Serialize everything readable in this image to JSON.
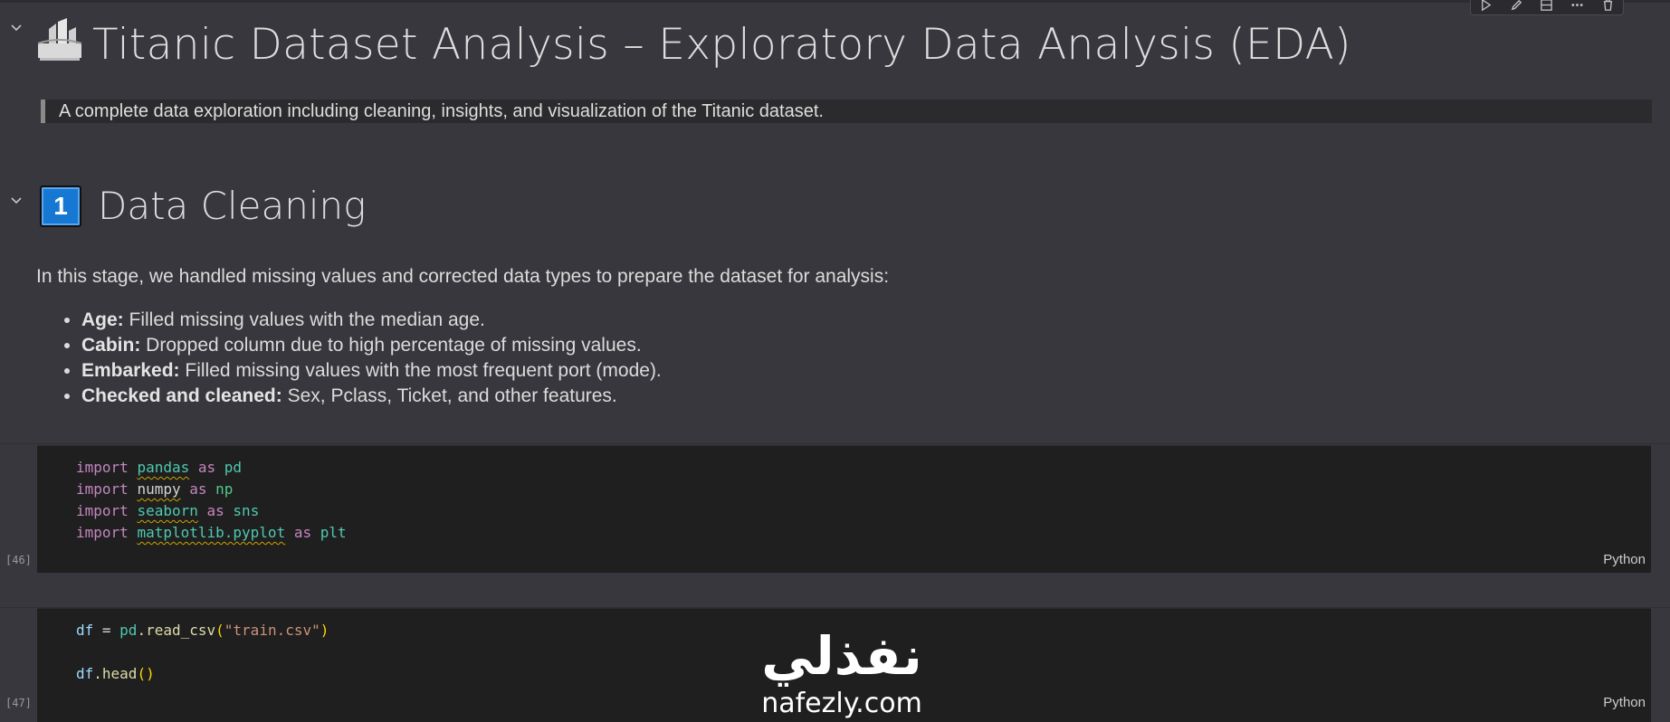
{
  "toolbar": {
    "icons": [
      "run-cell-icon",
      "edit-icon",
      "split-cell-icon",
      "more-icon",
      "delete-icon"
    ]
  },
  "heading": {
    "icon": "ship-icon",
    "title": "Titanic Dataset Analysis – Exploratory Data Analysis (EDA)"
  },
  "quote": "A complete data exploration including cleaning, insights, and visualization of the Titanic dataset.",
  "section": {
    "number": "1",
    "title": "Data Cleaning",
    "intro": "In this stage, we handled missing values and corrected data types to prepare the dataset for analysis:",
    "items": [
      {
        "label": "Age:",
        "text": " Filled missing values with the median age."
      },
      {
        "label": "Cabin:",
        "text": " Dropped column due to high percentage of missing values."
      },
      {
        "label": "Embarked:",
        "text": " Filled missing values with the most frequent port (mode)."
      },
      {
        "label": "Checked and cleaned:",
        "text": " Sex, Pclass, Ticket, and other features."
      }
    ]
  },
  "cells": [
    {
      "exec": "[46]",
      "language": "Python",
      "lines": [
        [
          "import",
          "pandas",
          "as",
          "pd"
        ],
        [
          "import",
          "numpy",
          "as",
          "np"
        ],
        [
          "import",
          "seaborn",
          "as",
          "sns"
        ],
        [
          "import",
          "matplotlib.pyplot",
          "as",
          "plt"
        ]
      ]
    },
    {
      "exec": "[47]",
      "language": "Python",
      "line1": {
        "var": "df",
        "eq": " = ",
        "obj": "pd",
        "fn": ".read_csv",
        "open": "(",
        "str": "\"train.csv\"",
        "close": ")"
      },
      "line2": {
        "var": "df",
        "fn": ".head",
        "parens": "()"
      }
    }
  ],
  "watermark": {
    "arabic": "نفذلي",
    "latin": "nafezly.com"
  },
  "colors": {
    "background": "#37373d",
    "code_background": "#1f1f1f",
    "keyword": "#c586c0",
    "module": "#4ec9b0",
    "badge": "#1778d4"
  }
}
